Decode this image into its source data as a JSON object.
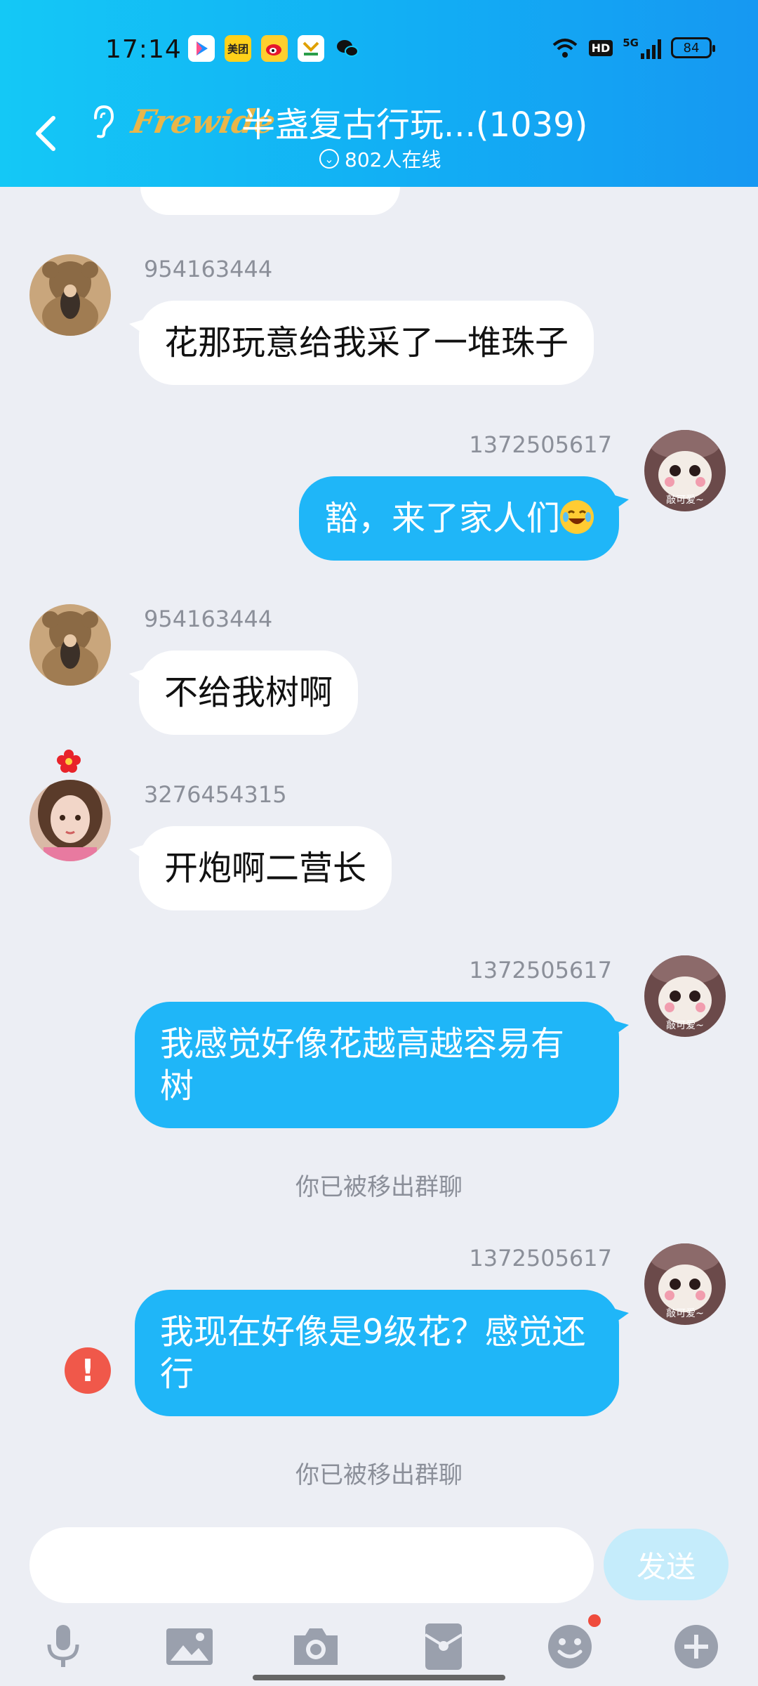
{
  "status_bar": {
    "time": "17:14",
    "apps": [
      {
        "name": "youku-icon",
        "label": "▶",
        "bg": "#ffffff",
        "fg": "#1e90ff"
      },
      {
        "name": "meituan-icon",
        "label": "美团",
        "bg": "#ffd11a",
        "fg": "#222"
      },
      {
        "name": "weibo-icon",
        "label": "微",
        "bg": "#ffcf2e",
        "fg": "#e6162d"
      },
      {
        "name": "store-icon",
        "label": "Y",
        "bg": "#ffffff",
        "fg": "#e0a000"
      },
      {
        "name": "wechat-icon",
        "label": "●",
        "bg": "transparent",
        "fg": "#111"
      }
    ],
    "network": "5G",
    "hd": "HD",
    "battery": "84"
  },
  "header": {
    "logo": "Frewide",
    "title": "半盏复古行玩...(1039)",
    "online": "802人在线"
  },
  "messages": [
    {
      "type": "in",
      "sender": "954163444",
      "text": "花那玩意给我采了一堆珠子"
    },
    {
      "type": "out",
      "sender": "1372505617",
      "text": "豁，来了家人们"
    },
    {
      "type": "in",
      "sender": "954163444",
      "text": "不给我树啊"
    },
    {
      "type": "in",
      "sender": "3276454315",
      "text": "开炮啊二营长"
    },
    {
      "type": "out",
      "sender": "1372505617",
      "text": "我感觉好像花越高越容易有树"
    },
    {
      "type": "system",
      "text": "你已被移出群聊"
    },
    {
      "type": "out",
      "sender": "1372505617",
      "text": "我现在好像是9级花？感觉还行",
      "failed": true
    },
    {
      "type": "system",
      "text": "你已被移出群聊"
    }
  ],
  "avatar_caption": "敲可爱~",
  "input": {
    "value": "",
    "placeholder": ""
  },
  "send_label": "发送",
  "toolbar": [
    "microphone-icon",
    "image-icon",
    "camera-icon",
    "red-packet-icon",
    "emoji-icon",
    "plus-icon"
  ],
  "colors": {
    "accent": "#1fb6f8",
    "header": "#14c8f6",
    "error": "#f0584a"
  }
}
